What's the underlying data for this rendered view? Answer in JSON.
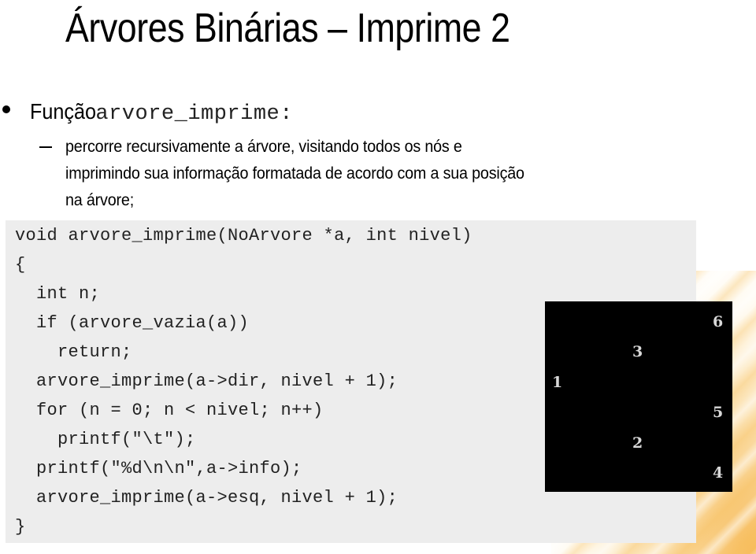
{
  "slide": {
    "title": "Árvores Binárias – Imprime 2",
    "bullet": {
      "label": "Função ",
      "code": "arvore_imprime:"
    },
    "sub_bullet": {
      "lines": [
        "percorre recursivamente a árvore, visitando todos os nós e",
        "imprimindo sua informação formatada de acordo com a sua posição",
        "na árvore;"
      ]
    },
    "code": {
      "lines": [
        "void arvore_imprime(NoArvore *a, int nivel)",
        "{",
        "  int n;",
        "  if (arvore_vazia(a))",
        "    return;",
        "  arvore_imprime(a->dir, nivel + 1);",
        "  for (n = 0; n < nivel; n++)",
        "    printf(\"\\t\");",
        "  printf(\"%d\\n\\n\",a->info);",
        "  arvore_imprime(a->esq, nivel + 1);",
        "}"
      ]
    },
    "console_output": {
      "nodes": [
        {
          "value": "6",
          "level": 2
        },
        {
          "value": "3",
          "level": 1
        },
        {
          "value": "1",
          "level": 0
        },
        {
          "value": "5",
          "level": 2
        },
        {
          "value": "2",
          "level": 1
        },
        {
          "value": "4",
          "level": 2
        }
      ]
    }
  }
}
